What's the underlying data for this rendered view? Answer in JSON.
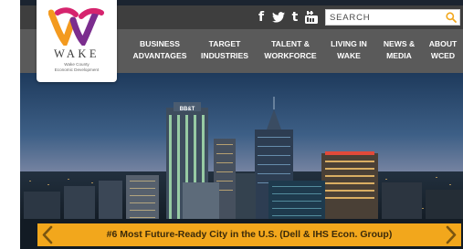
{
  "logo": {
    "wordmark": "WAKE",
    "subtitle_line1": "Wake County",
    "subtitle_line2": "Economic Development"
  },
  "utility": {
    "social": [
      {
        "name": "facebook",
        "glyph": "f"
      },
      {
        "name": "twitter",
        "glyph": ""
      },
      {
        "name": "tumblr",
        "glyph": "t"
      },
      {
        "name": "youtube",
        "glyph": ""
      }
    ],
    "search": {
      "placeholder": "SEARCH",
      "icon": "search-icon"
    }
  },
  "nav": {
    "items": [
      {
        "line1": "BUSINESS",
        "line2": "ADVANTAGES"
      },
      {
        "line1": "TARGET",
        "line2": "INDUSTRIES"
      },
      {
        "line1": "TALENT &",
        "line2": "WORKFORCE"
      },
      {
        "line1": "LIVING IN",
        "line2": "WAKE"
      },
      {
        "line1": "NEWS &",
        "line2": "MEDIA"
      },
      {
        "line1": "ABOUT",
        "line2": "WCED"
      }
    ]
  },
  "hero": {
    "building_sign": "BB&T",
    "caption": "#6 Most Future-Ready City in the U.S. (Dell & IHS Econ. Group)",
    "prev_icon": "chevron-left-icon",
    "next_icon": "chevron-right-icon"
  },
  "colors": {
    "utility_bar": "#3e3e3e",
    "nav_bar": "#5a5a5a",
    "banner": "#f2a71c",
    "logo_pink": "#d6246e",
    "logo_purple": "#7b2d8e",
    "logo_orange": "#f39a1f"
  }
}
